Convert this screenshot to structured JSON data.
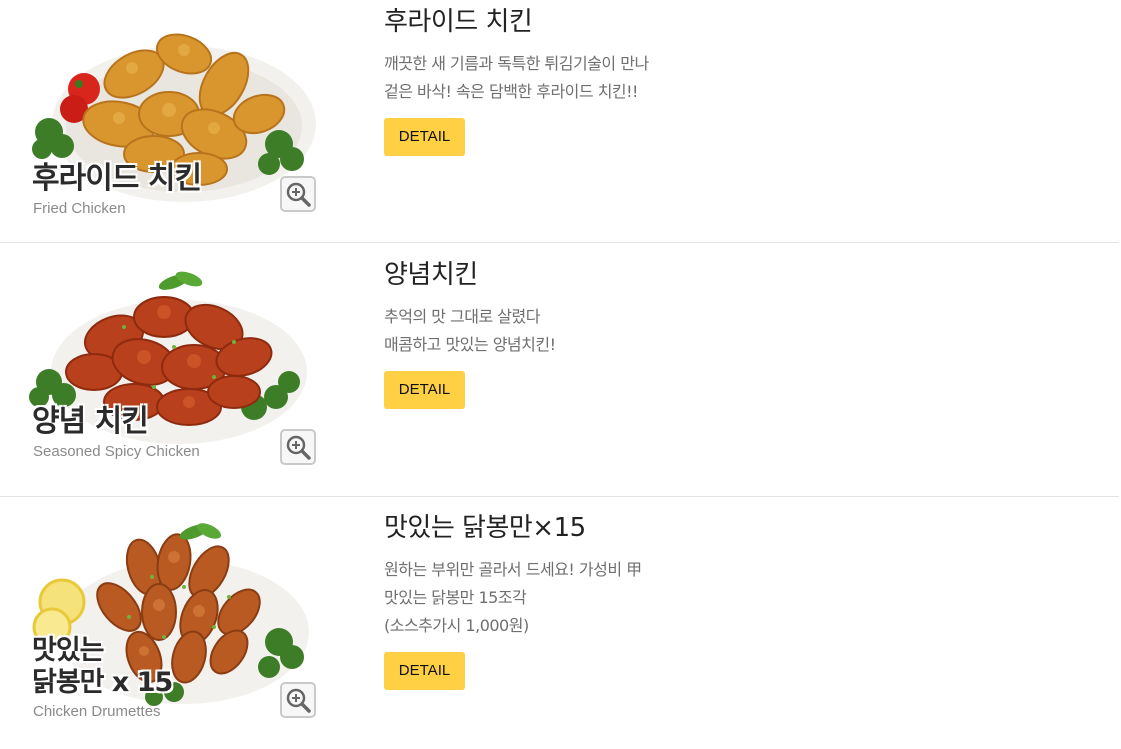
{
  "menu": [
    {
      "image_title": "후라이드 치킨",
      "image_subtitle": "Fried Chicken",
      "title": "후라이드 치킨",
      "desc_lines": [
        "깨끗한 새 기름과 독특한 튀김기술이 만나",
        "겉은 바삭! 속은 담백한 후라이드 치킨!!"
      ],
      "button_label": "DETAIL"
    },
    {
      "image_title": "양념 치킨",
      "image_subtitle": "Seasoned Spicy Chicken",
      "title": "양념치킨",
      "desc_lines": [
        "추억의 맛 그대로 살렸다",
        "매콤하고 맛있는 양념치킨!"
      ],
      "button_label": "DETAIL"
    },
    {
      "image_title_lines": [
        "맛있는",
        "닭봉만 x 15"
      ],
      "image_subtitle": "Chicken Drumettes",
      "title": "맛있는 닭봉만×15",
      "desc_lines": [
        "원하는 부위만 골라서 드세요! 가성비 甲",
        "맛있는 닭봉만 15조각",
        "(소스추가시 1,000원)"
      ],
      "button_label": "DETAIL"
    }
  ],
  "icons": {
    "zoom": "zoom-in-icon"
  },
  "colors": {
    "button_bg": "#ffcf44",
    "fried_chicken": "#d9962e",
    "spicy_chicken": "#b8401c",
    "drumette": "#b85a22",
    "parsley": "#3e7d28"
  }
}
